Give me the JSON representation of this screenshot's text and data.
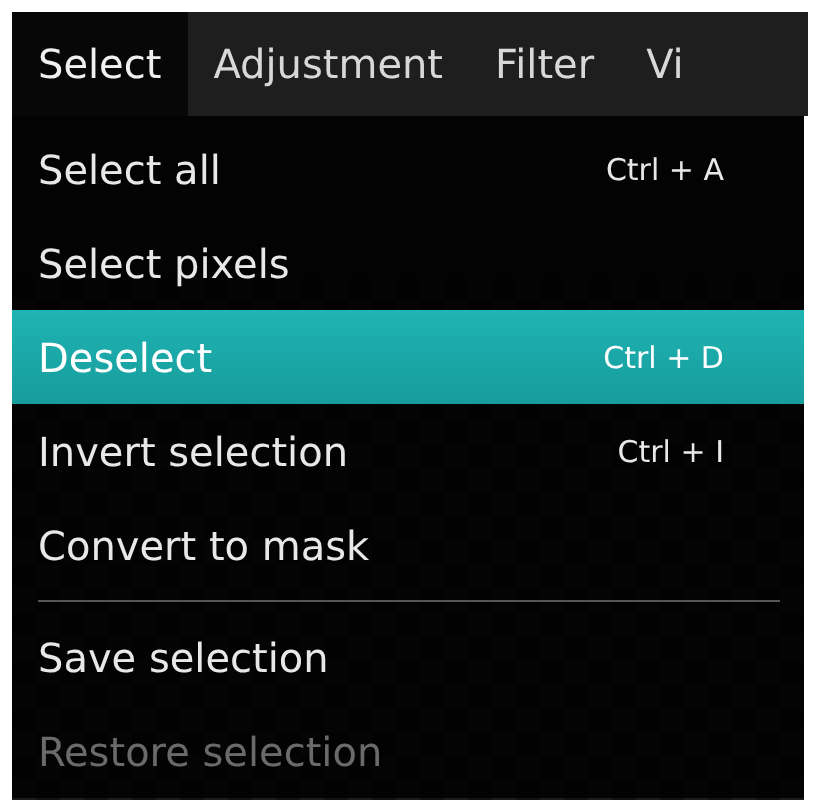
{
  "menubar": [
    {
      "label": "Select",
      "selected": true
    },
    {
      "label": "Adjustment",
      "selected": false
    },
    {
      "label": "Filter",
      "selected": false
    },
    {
      "label": "Vi",
      "selected": false
    }
  ],
  "menu": [
    {
      "kind": "item",
      "label": "Select all",
      "shortcut": "Ctrl + A",
      "selected": false,
      "disabled": false
    },
    {
      "kind": "item",
      "label": "Select pixels",
      "selected": false,
      "disabled": false
    },
    {
      "kind": "item",
      "label": "Deselect",
      "shortcut": "Ctrl + D",
      "selected": true,
      "disabled": false
    },
    {
      "kind": "item",
      "label": "Invert selection",
      "shortcut": "Ctrl + I",
      "selected": false,
      "disabled": false
    },
    {
      "kind": "item",
      "label": "Convert to mask",
      "selected": false,
      "disabled": false
    },
    {
      "kind": "separator"
    },
    {
      "kind": "item",
      "label": "Save selection",
      "selected": false,
      "disabled": false
    },
    {
      "kind": "item",
      "label": "Restore selection",
      "selected": false,
      "disabled": true
    }
  ]
}
